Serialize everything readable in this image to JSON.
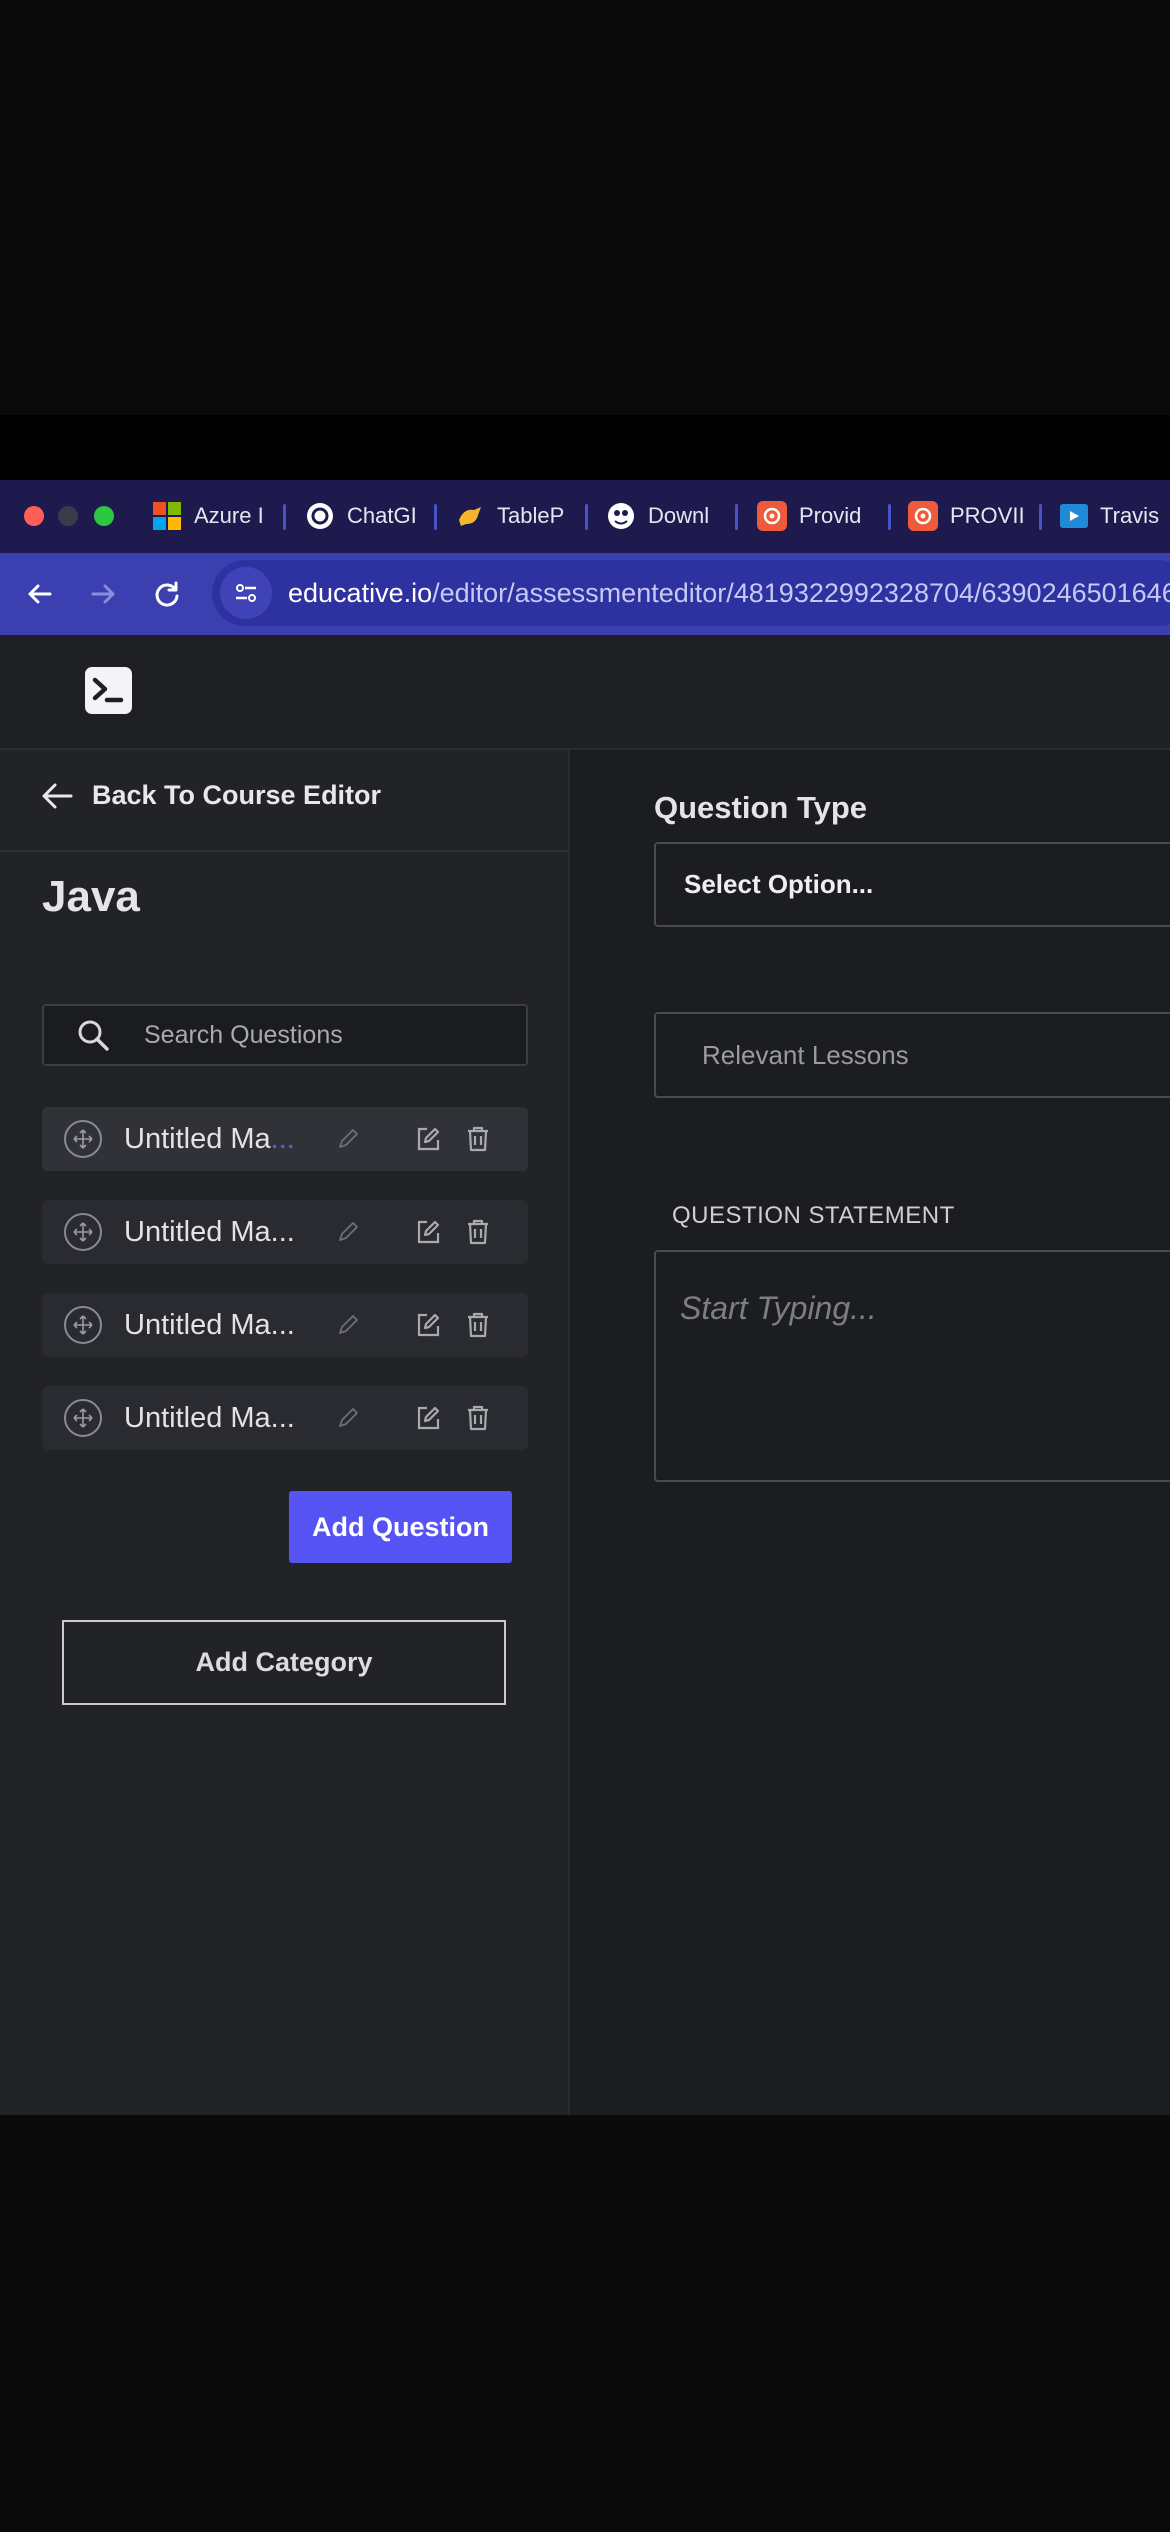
{
  "browser": {
    "tabs": [
      {
        "label": "Azure I",
        "icon": "microsoft-icon"
      },
      {
        "label": "ChatGI",
        "icon": "chatgpt-icon"
      },
      {
        "label": "TableP",
        "icon": "tableplus-icon"
      },
      {
        "label": "Downl",
        "icon": "download-icon"
      },
      {
        "label": "Provid",
        "icon": "provider-icon"
      },
      {
        "label": "PROVII",
        "icon": "provider-icon"
      },
      {
        "label": "Travis",
        "icon": "travis-icon"
      }
    ],
    "url_host": "educative.io",
    "url_path": "/editor/assessmenteditor/4819322992328704/6390246501646"
  },
  "sidebar": {
    "back_label": "Back To Course Editor",
    "course_title": "Java",
    "search_placeholder": "Search Questions",
    "questions": [
      {
        "label": "Untitled Ma",
        "ellipsis": "...",
        "active": true
      },
      {
        "label": "Untitled Ma",
        "ellipsis": "...",
        "active": false
      },
      {
        "label": "Untitled Ma",
        "ellipsis": "...",
        "active": false
      },
      {
        "label": "Untitled Ma",
        "ellipsis": "...",
        "active": false
      }
    ],
    "add_question_label": "Add Question",
    "add_category_label": "Add Category"
  },
  "main": {
    "question_type_label": "Question Type",
    "select_placeholder": "Select Option...",
    "relevant_lessons_placeholder": "Relevant Lessons",
    "statement_label": "QUESTION STATEMENT",
    "statement_placeholder": "Start Typing..."
  },
  "colors": {
    "tabbar": "#1e1a4e",
    "navbar": "#3b3fb0",
    "accent": "#5553f3",
    "sidebar_bg": "#222326",
    "main_bg": "#1c1d20"
  }
}
